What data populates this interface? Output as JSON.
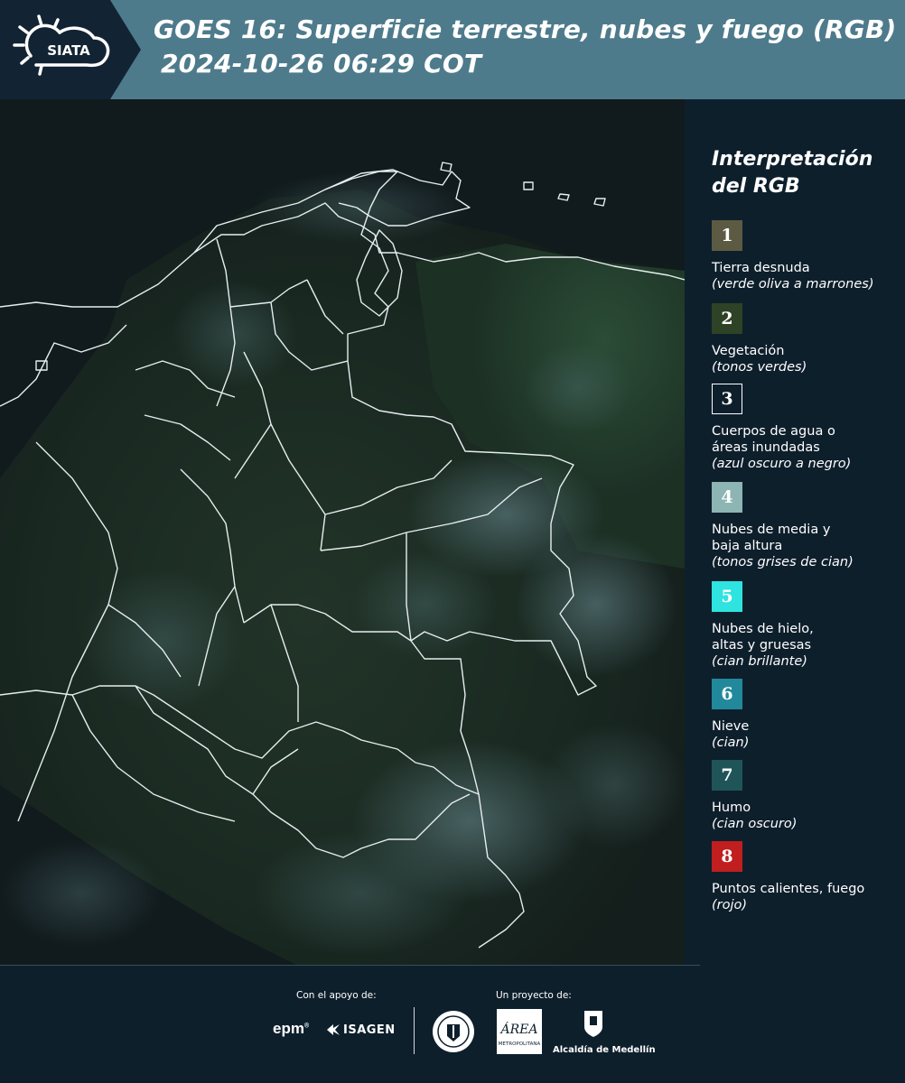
{
  "header": {
    "brand": "SIATA",
    "title_line1": "GOES 16: Superficie terrestre, nubes y fuego (RGB)",
    "title_line2": "2024-10-26 06:29 COT"
  },
  "legend": {
    "title_line1": "Interpretación",
    "title_line2": "del RGB",
    "items": [
      {
        "num": "1",
        "color": "#5c5a42",
        "lines": [
          "Tierra desnuda"
        ],
        "desc": "(verde oliva a marrones)"
      },
      {
        "num": "2",
        "color": "#2e4226",
        "lines": [
          "Vegetación"
        ],
        "desc": "(tonos verdes)"
      },
      {
        "num": "3",
        "color": "#0e1f2c",
        "lines": [
          "Cuerpos de agua o",
          "áreas inundadas"
        ],
        "desc": "(azul oscuro a negro)"
      },
      {
        "num": "4",
        "color": "#8cb5b3",
        "lines": [
          "Nubes de media y",
          "baja altura"
        ],
        "desc": "(tonos grises de cian)"
      },
      {
        "num": "5",
        "color": "#2fe3e0",
        "lines": [
          "Nubes de hielo,",
          "altas y gruesas"
        ],
        "desc": "(cian brillante)"
      },
      {
        "num": "6",
        "color": "#21899b",
        "lines": [
          "Nieve"
        ],
        "desc": "(cian)"
      },
      {
        "num": "7",
        "color": "#1f5558",
        "lines": [
          "Humo"
        ],
        "desc": "(cian oscuro)"
      },
      {
        "num": "8",
        "color": "#c01e1f",
        "lines": [
          "Puntos calientes, fuego"
        ],
        "desc": "(rojo)"
      }
    ]
  },
  "footer": {
    "support_label": "Con el apoyo de:",
    "project_label": "Un proyecto de:",
    "epm": "epm",
    "isagen": "ISAGEN",
    "metro_line1": "ÁREA",
    "metro_line2": "METROPOLITANA",
    "alcaldia": "Alcaldía de Medellín"
  }
}
